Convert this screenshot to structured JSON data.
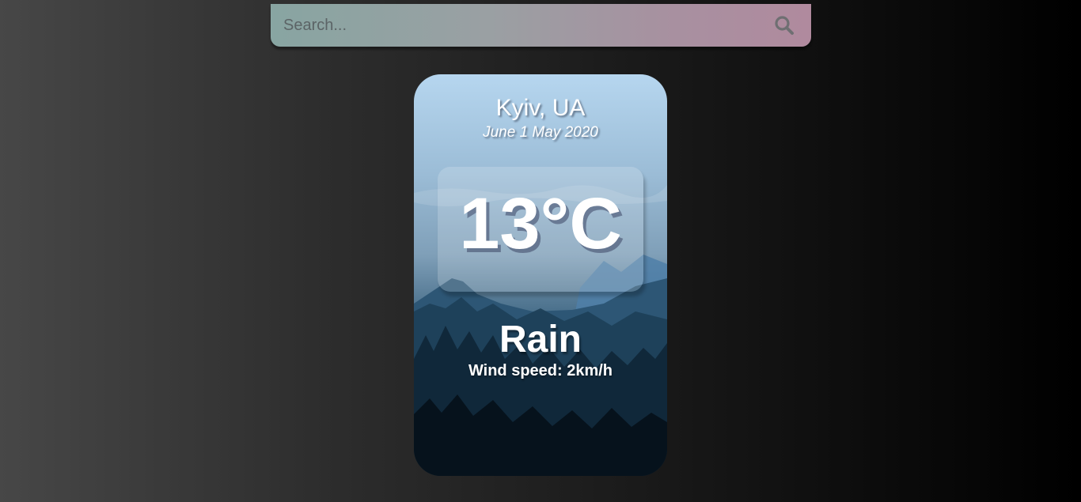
{
  "search": {
    "placeholder": "Search...",
    "value": "",
    "icon": "search-icon"
  },
  "weather": {
    "location": "Kyiv, UA",
    "date": "June 1 May 2020",
    "temperature": "13°C",
    "condition": "Rain",
    "wind": "Wind speed: 2km/h"
  },
  "colors": {
    "search_gradient_start": "#88a5a2",
    "search_gradient_end": "#b08a9e",
    "card_sky": "#b6d6ef",
    "card_forest": "#0a1a28",
    "text": "#ffffff"
  }
}
